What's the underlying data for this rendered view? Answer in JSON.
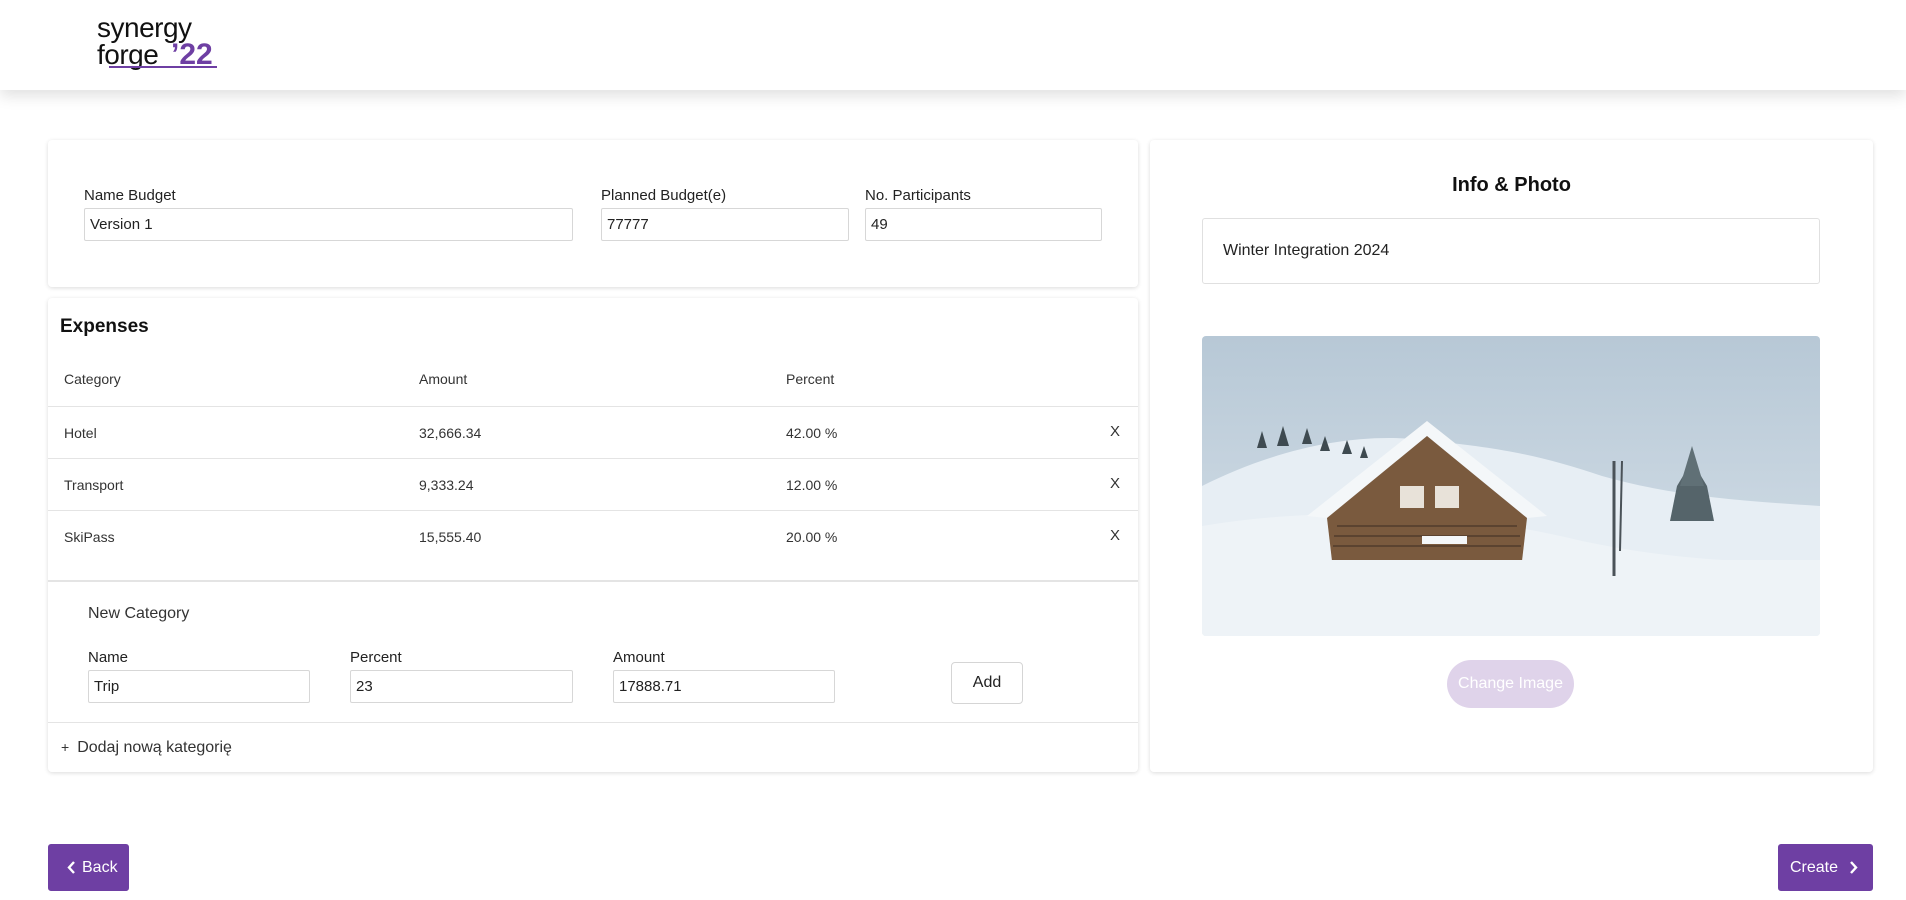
{
  "brand": {
    "logo_text_line1": "synergy",
    "logo_text_line2": "forge",
    "logo_year": "’22",
    "accent_color": "#6e3fa3"
  },
  "budget": {
    "name_label": "Name Budget",
    "name_value": "Version 1",
    "planned_label": "Planned Budget(e)",
    "planned_value": "77777",
    "participants_label": "No. Participants",
    "participants_value": "49"
  },
  "expenses": {
    "title": "Expenses",
    "columns": {
      "category": "Category",
      "amount": "Amount",
      "percent": "Percent"
    },
    "rows": [
      {
        "category": "Hotel",
        "amount": "32,666.34",
        "percent": "42.00 %",
        "delete": "X"
      },
      {
        "category": "Transport",
        "amount": "9,333.24",
        "percent": "12.00 %",
        "delete": "X"
      },
      {
        "category": "SkiPass",
        "amount": "15,555.40",
        "percent": "20.00 %",
        "delete": "X"
      }
    ]
  },
  "new_category": {
    "title": "New Category",
    "name_label": "Name",
    "name_value": "Trip",
    "percent_label": "Percent",
    "percent_value": "23",
    "amount_label": "Amount",
    "amount_value": "17888.71",
    "add_label": "Add",
    "add_new_plus": "+",
    "add_new_label": "Dodaj nową kategorię"
  },
  "info": {
    "title": "Info & Photo",
    "description": "Winter Integration 2024",
    "change_image_label": "Change Image"
  },
  "nav": {
    "back_label": "Back",
    "create_label": "Create"
  }
}
